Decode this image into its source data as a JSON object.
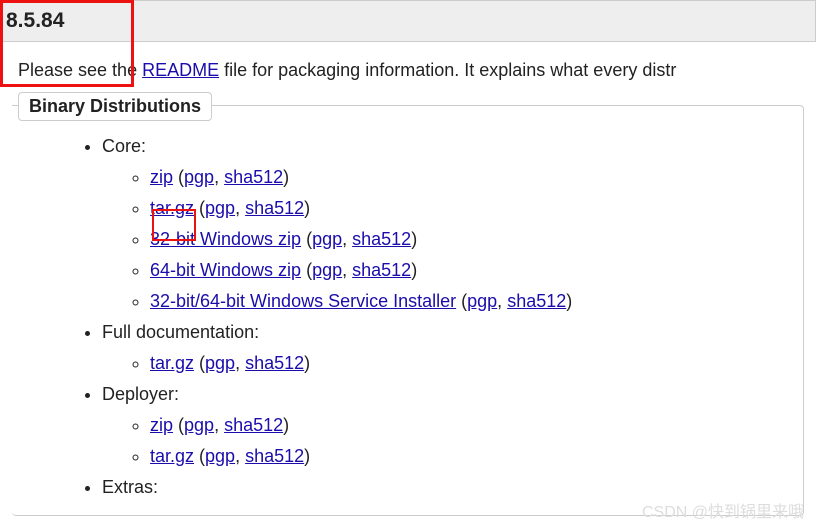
{
  "version": "8.5.84",
  "intro_prefix": "Please see the ",
  "readme_link": "README",
  "intro_suffix": " file for packaging information. It explains what every distr",
  "section_title": "Binary Distributions",
  "sig": {
    "pgp": "pgp",
    "sha512": "sha512"
  },
  "categories": {
    "core": {
      "label": "Core:"
    },
    "fulldoc": {
      "label": "Full documentation:"
    },
    "deployer": {
      "label": "Deployer:"
    },
    "extras": {
      "label": "Extras:"
    }
  },
  "links": {
    "zip": "zip",
    "targz": "tar.gz",
    "win32zip": "32-bit Windows zip",
    "win64zip": "64-bit Windows zip",
    "wininstaller": "32-bit/64-bit Windows Service Installer"
  },
  "watermark": "CSDN @快到锅里来哦"
}
